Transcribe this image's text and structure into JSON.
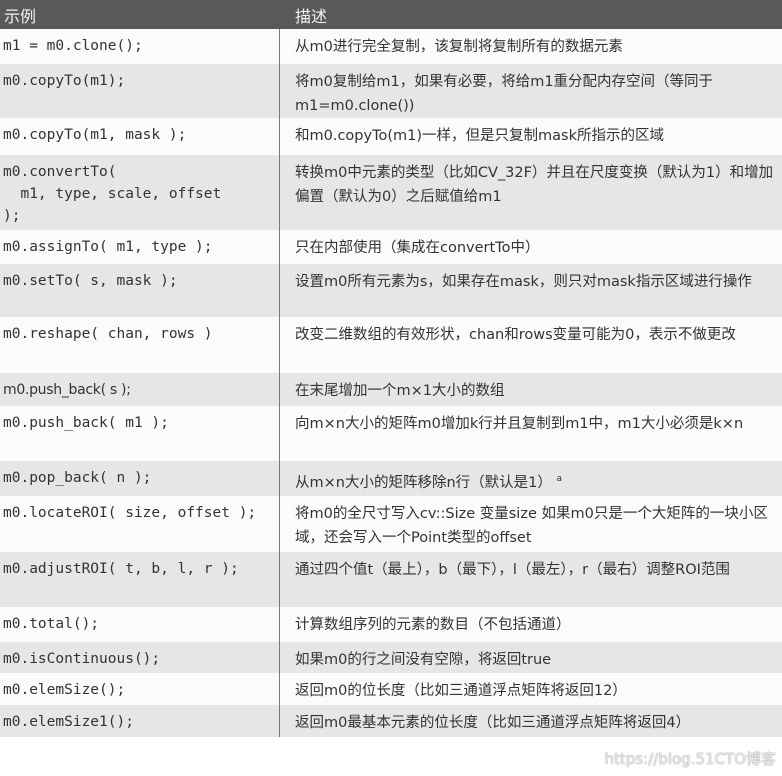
{
  "header": {
    "col_example": "示例",
    "col_description": "描述"
  },
  "rows": [
    {
      "example": "m1 = m0.clone();",
      "description": "从m0进行完全复制，该复制将复制所有的数据元素"
    },
    {
      "example": "m0.copyTo(m1);",
      "description": "将m0复制给m1，如果有必要，将给m1重分配内存空间（等同于m1=m0.clone())"
    },
    {
      "example": "m0.copyTo(m1, mask );",
      "description": "和m0.copyTo(m1)一样，但是只复制mask所指示的区域"
    },
    {
      "example": "m0.convertTo(\n  m1, type, scale, offset\n);",
      "description": "转换m0中元素的类型（比如CV_32F）并且在尺度变换（默认为1）和增加偏置（默认为0）之后赋值给m1"
    },
    {
      "example": "m0.assignTo( m1, type );",
      "description": "只在内部使用（集成在convertTo中）"
    },
    {
      "example": "m0.setTo( s, mask );",
      "description": "设置m0所有元素为s，如果存在mask，则只对mask指示区域进行操作"
    },
    {
      "example": "m0.reshape( chan, rows )",
      "description": "改变二维数组的有效形状，chan和rows变量可能为0，表示不做更改"
    },
    {
      "example": "m0.push_back( s );",
      "description": "在末尾增加一个m×1大小的数组"
    },
    {
      "example": "m0.push_back( m1 );",
      "description": "向m×n大小的矩阵m0增加k行并且复制到m1中，m1大小必须是k×n"
    },
    {
      "example": "m0.pop_back( n );",
      "description": "从m×n大小的矩阵移除n行（默认是1）",
      "footnote": "a"
    },
    {
      "example": "m0.locateROI( size, offset );",
      "description": "将m0的全尺寸写入cv::Size 变量size 如果m0只是一个大矩阵的一块小区域，还会写入一个Point类型的offset"
    },
    {
      "example": "m0.adjustROI( t, b, l, r );",
      "description": "通过四个值t（最上），b（最下），l（最左），r（最右）调整ROI范围"
    },
    {
      "example": "m0.total();",
      "description": "计算数组序列的元素的数目（不包括通道）"
    },
    {
      "example": "m0.isContinuous();",
      "description": "如果m0的行之间没有空隙，将返回true"
    },
    {
      "example": "m0.elemSize();",
      "description": "返回m0的位长度（比如三通道浮点矩阵将返回12）"
    },
    {
      "example": "m0.elemSize1();",
      "description": "返回m0最基本元素的位长度（比如三通道浮点矩阵将返回4）"
    }
  ],
  "watermark": "https://blog.51CTO博客"
}
